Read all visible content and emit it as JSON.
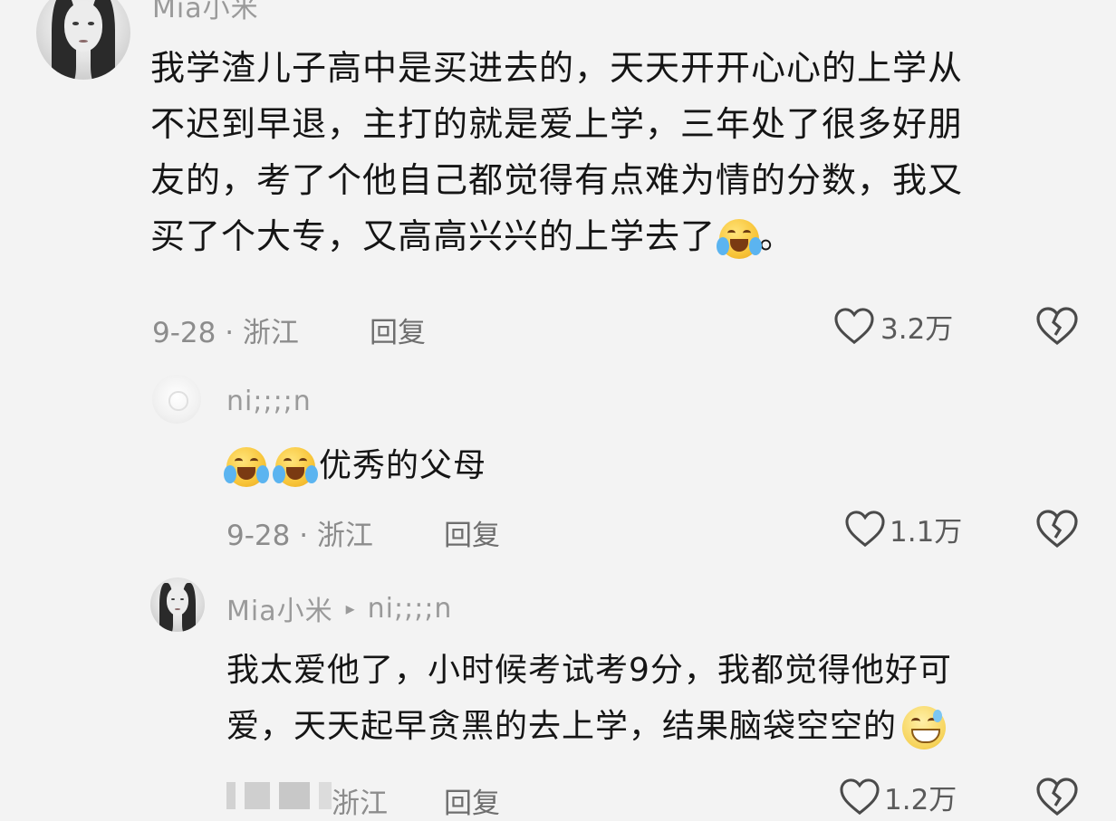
{
  "comments": [
    {
      "username": "Mia小米",
      "content_lines": [
        "我学渣儿子高中是买进去的，天天开开心心的上学从",
        "不迟到早退，主打的就是爱上学，三年处了很多好朋",
        "友的，考了个他自己都觉得有点难为情的分数，我又",
        "买了个大专，又高高兴兴的上学去了"
      ],
      "content_tail": "。",
      "date_location": "9-28 · 浙江",
      "reply_label": "回复",
      "likes": "3.2万",
      "emoji": "laughing-crying"
    },
    {
      "username": "ni;;;;n",
      "content": "优秀的父母",
      "date_location": "9-28 · 浙江",
      "reply_label": "回复",
      "likes": "1.1万",
      "emoji": "laughing-crying"
    },
    {
      "username": "Mia小米",
      "reply_to_arrow": "▸",
      "reply_to": "ni;;;;n",
      "content_lines": [
        "我太爱他了，小时候考试考9分，我都觉得他好可",
        "爱，天天起早贪黑的去上学，结果脑袋空空的"
      ],
      "date_location": "浙江",
      "reply_label": "回复",
      "likes": "1.2万",
      "emoji": "grinning-sweat"
    }
  ],
  "colors": {
    "background": "#f3f3f3",
    "text": "#151515",
    "meta": "#8c8c8c"
  }
}
